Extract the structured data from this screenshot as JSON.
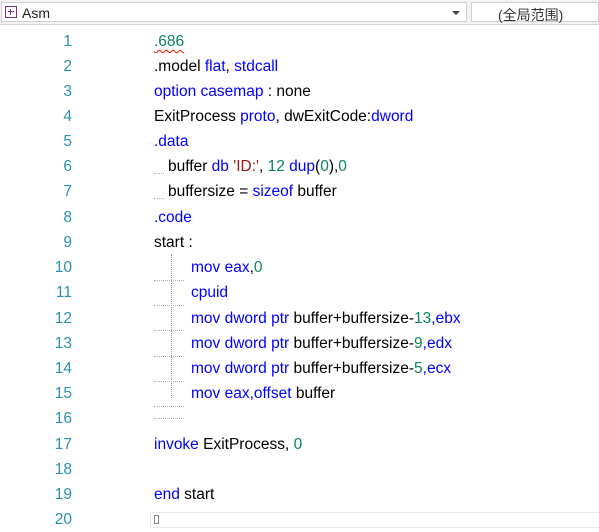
{
  "navbar": {
    "scope_label": "Asm",
    "member_label": "(全局范围)"
  },
  "lines": [
    {
      "n": "1"
    },
    {
      "n": "2"
    },
    {
      "n": "3"
    },
    {
      "n": "4"
    },
    {
      "n": "5"
    },
    {
      "n": "6"
    },
    {
      "n": "7"
    },
    {
      "n": "8"
    },
    {
      "n": "9"
    },
    {
      "n": "10"
    },
    {
      "n": "11"
    },
    {
      "n": "12"
    },
    {
      "n": "13"
    },
    {
      "n": "14"
    },
    {
      "n": "15"
    },
    {
      "n": "16"
    },
    {
      "n": "17"
    },
    {
      "n": "18"
    },
    {
      "n": "19"
    },
    {
      "n": "20"
    }
  ],
  "code": {
    "l1": ".686",
    "l2_a": ".model ",
    "l2_b": "flat",
    "l2_c": ", ",
    "l2_d": "stdcall",
    "l3_a": "option ",
    "l3_b": "casemap",
    "l3_c": " : none",
    "l4_a": "ExitProcess ",
    "l4_b": "proto",
    "l4_c": ", dwExitCode:",
    "l4_d": "dword",
    "l5": ".data",
    "l6_a": "buffer ",
    "l6_b": "db",
    "l6_c": " ",
    "l6_d": "'ID:'",
    "l6_e": ", ",
    "l6_f": "12",
    "l6_g": " ",
    "l6_h": "dup",
    "l6_i": "(",
    "l6_j": "0",
    "l6_k": "),",
    "l6_l": "0",
    "l7_a": "buffersize = ",
    "l7_b": "sizeof",
    "l7_c": " buffer",
    "l8": ".code",
    "l9": "start :",
    "l10_a": "mov eax",
    "l10_b": ",",
    "l10_c": "0",
    "l11": "cpuid",
    "l12_a": "mov dword ptr ",
    "l12_b": "buffer+buffersize-",
    "l12_c": "13",
    "l12_d": ",ebx",
    "l13_a": "mov dword ptr ",
    "l13_b": "buffer+buffersize-",
    "l13_c": "9",
    "l13_d": ",edx",
    "l14_a": "mov dword ptr ",
    "l14_b": "buffer+buffersize-",
    "l14_c": "5",
    "l14_d": ",ecx",
    "l15_a": "mov eax",
    "l15_b": ",offset ",
    "l15_c": "buffer",
    "l17_a": "invoke",
    "l17_b": " ExitProcess, ",
    "l17_c": "0",
    "l19_a": "end",
    "l19_b": " start"
  },
  "colors": {
    "line_number": "#2b91af",
    "keyword": "#0000ff",
    "number": "#098658",
    "string": "#a31515",
    "squiggle": "#e51400"
  },
  "icons": {
    "scope": "collapse-box-icon",
    "dropdown": "chevron-down-icon"
  }
}
